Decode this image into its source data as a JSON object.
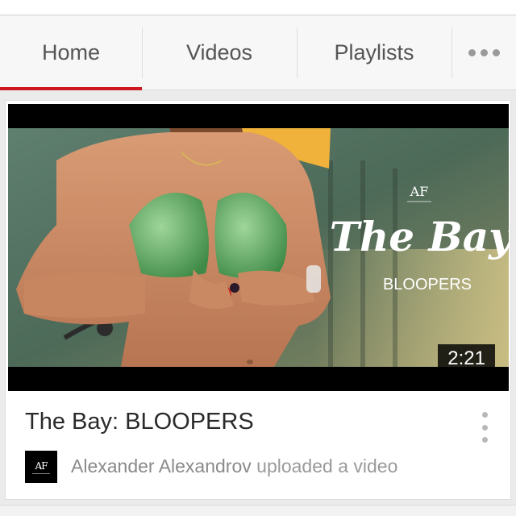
{
  "theme": {
    "accent": "#cc181e"
  },
  "tabs": [
    {
      "label": "Home",
      "active": true
    },
    {
      "label": "Videos",
      "active": false
    },
    {
      "label": "Playlists",
      "active": false
    }
  ],
  "more_icon": "more-horizontal-icon",
  "video": {
    "title": "The Bay: BLOOPERS",
    "duration": "2:21",
    "thumbnail": {
      "logo": "AF",
      "headline": "The Bay",
      "subheadline": "BLOOPERS"
    },
    "menu_icon": "more-vertical-icon"
  },
  "activity": {
    "channel": "Alexander Alexandrov",
    "action": "uploaded a video",
    "avatar_logo": "AF"
  }
}
